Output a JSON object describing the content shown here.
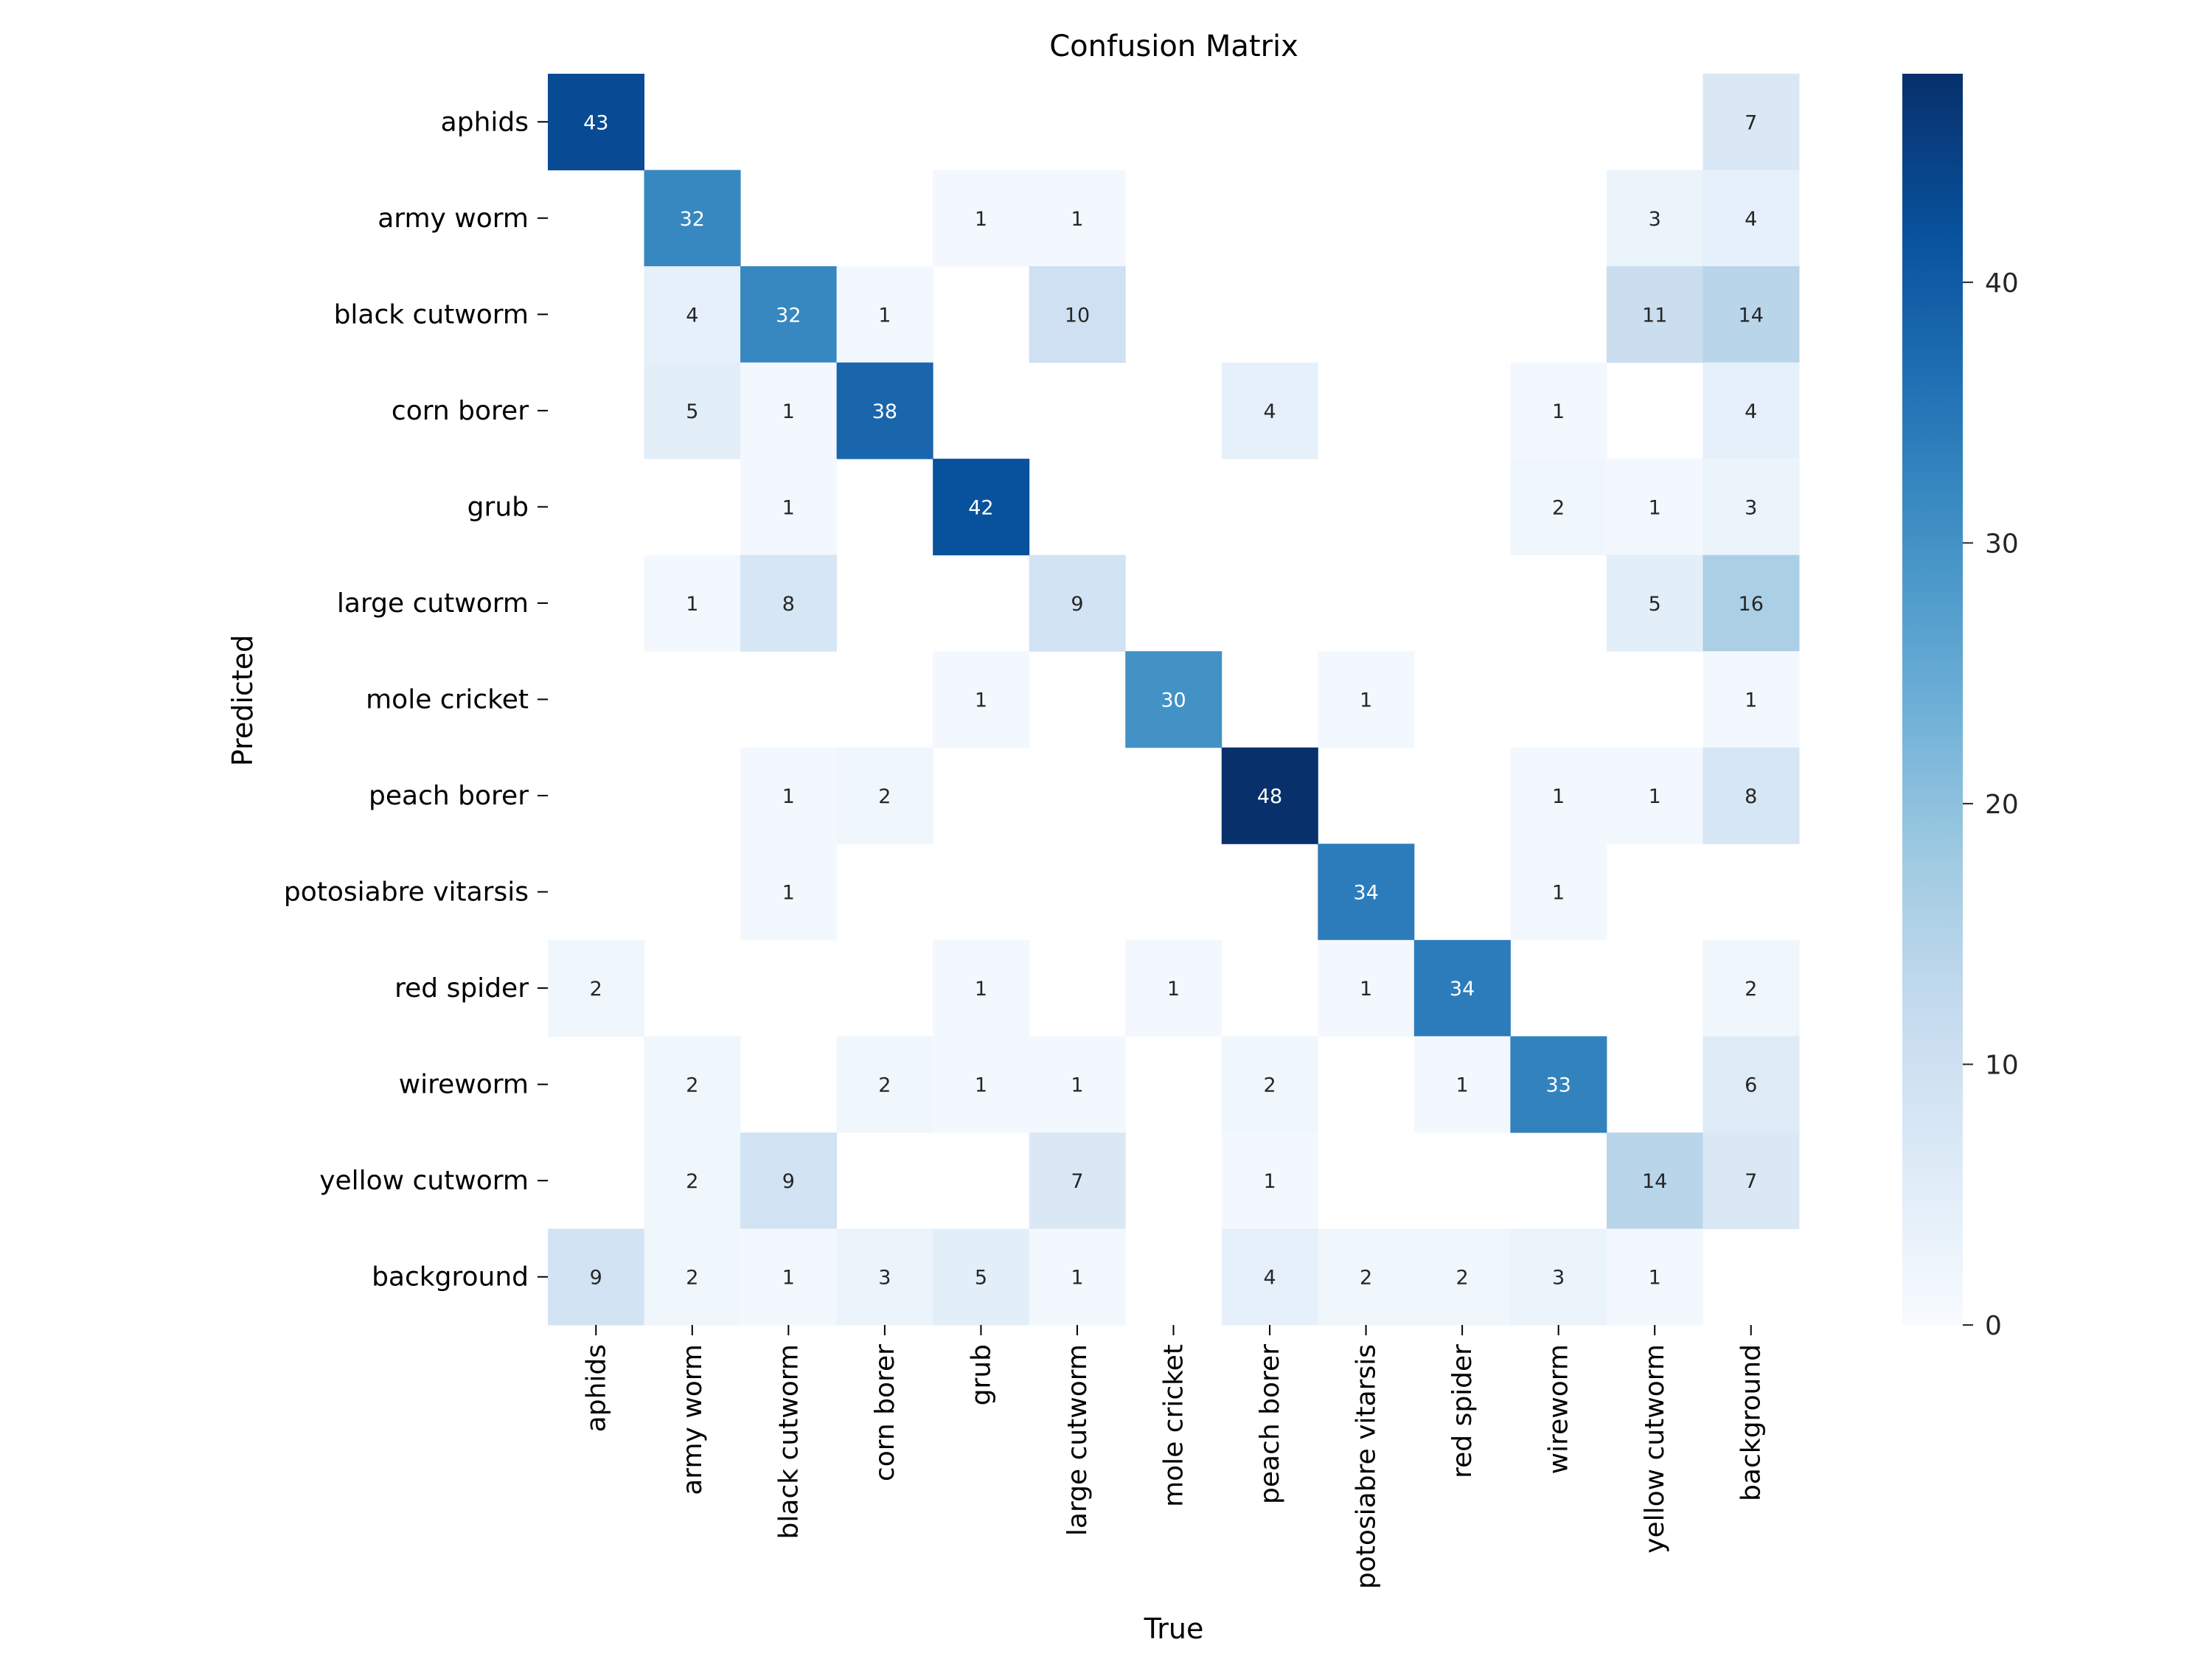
{
  "chart_data": {
    "type": "heatmap",
    "title": "Confusion Matrix",
    "xlabel": "True",
    "ylabel": "Predicted",
    "row_labels": [
      "aphids",
      "army worm",
      "black cutworm",
      "corn borer",
      "grub",
      "large cutworm",
      "mole cricket",
      "peach borer",
      "potosiabre vitarsis",
      "red spider",
      "wireworm",
      "yellow cutworm",
      "background"
    ],
    "col_labels": [
      "aphids",
      "army worm",
      "black cutworm",
      "corn borer",
      "grub",
      "large cutworm",
      "mole cricket",
      "peach borer",
      "potosiabre vitarsis",
      "red spider",
      "wireworm",
      "yellow cutworm",
      "background"
    ],
    "values": [
      [
        43,
        0,
        0,
        0,
        0,
        0,
        0,
        0,
        0,
        0,
        0,
        0,
        7
      ],
      [
        0,
        32,
        0,
        0,
        1,
        1,
        0,
        0,
        0,
        0,
        0,
        3,
        4
      ],
      [
        0,
        4,
        32,
        1,
        0,
        10,
        0,
        0,
        0,
        0,
        0,
        11,
        14
      ],
      [
        0,
        5,
        1,
        38,
        0,
        0,
        0,
        4,
        0,
        0,
        1,
        0,
        4
      ],
      [
        0,
        0,
        1,
        0,
        42,
        0,
        0,
        0,
        0,
        0,
        2,
        1,
        3
      ],
      [
        0,
        1,
        8,
        0,
        0,
        9,
        0,
        0,
        0,
        0,
        0,
        5,
        16
      ],
      [
        0,
        0,
        0,
        0,
        1,
        0,
        30,
        0,
        1,
        0,
        0,
        0,
        1
      ],
      [
        0,
        0,
        1,
        2,
        0,
        0,
        0,
        48,
        0,
        0,
        1,
        1,
        8
      ],
      [
        0,
        0,
        1,
        0,
        0,
        0,
        0,
        0,
        34,
        0,
        1,
        0,
        0
      ],
      [
        2,
        0,
        0,
        0,
        1,
        0,
        1,
        0,
        1,
        34,
        0,
        0,
        2
      ],
      [
        0,
        2,
        0,
        2,
        1,
        1,
        0,
        2,
        0,
        1,
        33,
        0,
        6
      ],
      [
        0,
        2,
        9,
        0,
        0,
        7,
        0,
        1,
        0,
        0,
        0,
        14,
        7
      ],
      [
        9,
        2,
        1,
        3,
        5,
        1,
        0,
        4,
        2,
        2,
        3,
        1,
        0
      ]
    ],
    "zero_cells_hidden": true,
    "colormap": "Blues",
    "colorbar": {
      "min": 0,
      "max": 48,
      "ticks": [
        0,
        10,
        20,
        30,
        40
      ]
    },
    "grid": false,
    "legend": "colorbar-right"
  }
}
